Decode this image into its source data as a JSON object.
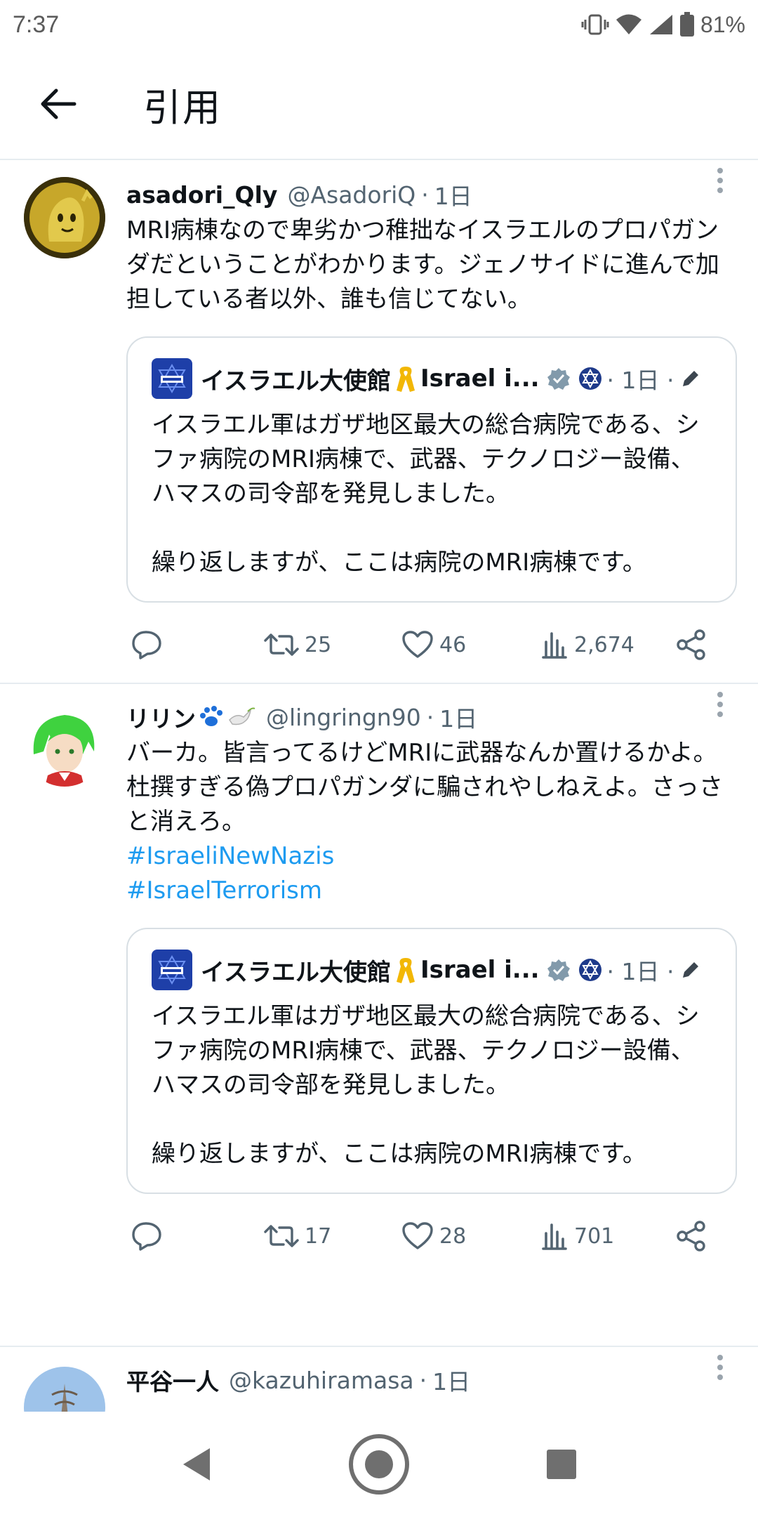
{
  "status": {
    "time": "7:37",
    "battery": "81%"
  },
  "header": {
    "title": "引用"
  },
  "posts": [
    {
      "display_name": "asadori_Qly",
      "handle": "@AsadoriQ",
      "time": "1日",
      "text": "MRI病棟なので卑劣かつ稚拙なイスラエルのプロパガンダだということがわかります。ジェノサイドに進んで加担している者以外、誰も信じてない。",
      "hashtags": [],
      "quote": {
        "name": "イスラエル大使館",
        "name2": "Israel i...",
        "time": "1日",
        "text": "イスラエル軍はガザ地区最大の総合病院である、シファ病院のMRI病棟で、武器、テクノロジー設備、ハマスの司令部を発見しました。\n\n繰り返しますが、ここは病院のMRI病棟です。"
      },
      "retweets": "25",
      "likes": "46",
      "views": "2,674"
    },
    {
      "display_name": "リリン",
      "handle": "@lingringn90",
      "time": "1日",
      "text": "バーカ。皆言ってるけどMRIに武器なんか置けるかよ。\n杜撰すぎる偽プロパガンダに騙されやしねえよ。さっさと消えろ。\n",
      "hashtags": [
        "#IsraeliNewNazis",
        "#IsraelTerrorism"
      ],
      "quote": {
        "name": "イスラエル大使館",
        "name2": "Israel i...",
        "time": "1日",
        "text": "イスラエル軍はガザ地区最大の総合病院である、シファ病院のMRI病棟で、武器、テクノロジー設備、ハマスの司令部を発見しました。\n\n繰り返しますが、ここは病院のMRI病棟です。"
      },
      "retweets": "17",
      "likes": "28",
      "views": "701"
    },
    {
      "display_name": "平谷一人",
      "handle": "@kazuhiramasa",
      "time": "1日"
    }
  ],
  "colors": {
    "link": "#1d9bf0",
    "muted": "#536471",
    "verified": "#829aab"
  }
}
